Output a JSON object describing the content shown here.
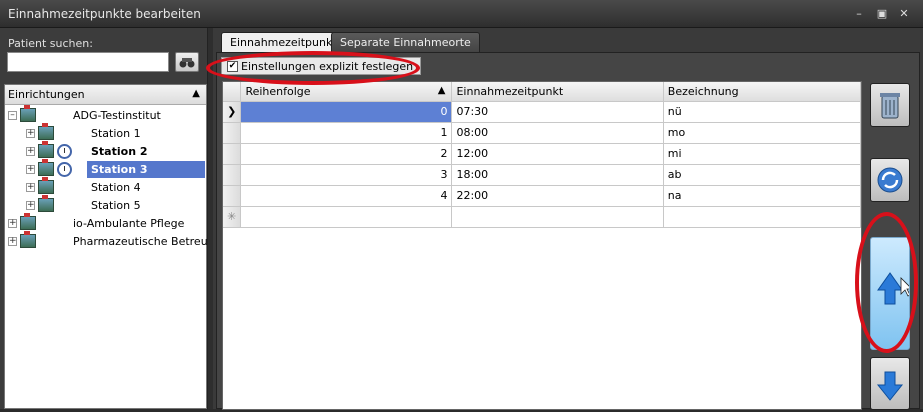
{
  "window": {
    "title": "Einnahmezeitpunkte bearbeiten",
    "min_glyph": "–",
    "max_glyph": "▣",
    "close_glyph": "✕"
  },
  "left": {
    "search_label": "Patient suchen:",
    "search_value": "",
    "tree_header": "Einrichtungen",
    "tree_header_arrow": "▲",
    "nodes": [
      {
        "label": "ADG-Testinstitut"
      },
      {
        "label": "Station 1"
      },
      {
        "label": "Station 2"
      },
      {
        "label": "Station 3"
      },
      {
        "label": "Station 4"
      },
      {
        "label": "Station 5"
      },
      {
        "label": "io-Ambulante Pflege"
      },
      {
        "label": "Pharmazeutische Betreu…"
      }
    ]
  },
  "tabs": [
    {
      "label": "Einnahmezeitpunkte"
    },
    {
      "label": "Separate Einnahmeorte"
    }
  ],
  "checkbox": {
    "label": "Einstellungen explizit festlegen",
    "checked": true,
    "mark": "✔"
  },
  "grid": {
    "columns": [
      "Reihenfolge",
      "Einnahmezeitpunkt",
      "Bezeichnung"
    ],
    "sort_arrow": "▲",
    "current_row_glyph": "❯",
    "new_row_glyph": "✳",
    "rows": [
      {
        "order": "0",
        "time": "07:30",
        "name": "nü"
      },
      {
        "order": "1",
        "time": "08:00",
        "name": "mo"
      },
      {
        "order": "2",
        "time": "12:00",
        "name": "mi"
      },
      {
        "order": "3",
        "time": "18:00",
        "name": "ab"
      },
      {
        "order": "4",
        "time": "22:00",
        "name": "na"
      }
    ]
  },
  "colors": {
    "accent": "#5d80d4",
    "highlight_ring": "#d8101a",
    "arrow_blue": "#2a7ad8"
  }
}
